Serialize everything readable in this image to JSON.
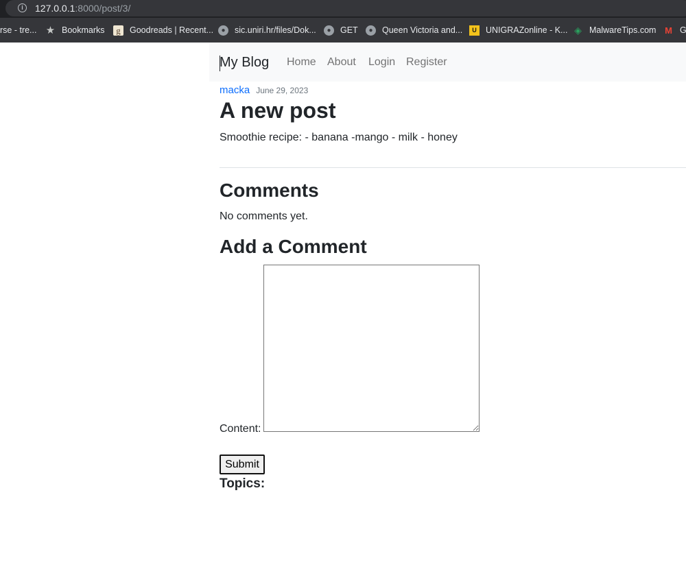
{
  "browser": {
    "url_host": "127.0.0.1",
    "url_path": ":8000/post/3/",
    "bookmarks": [
      {
        "label": "rse - tre...",
        "icon": "none"
      },
      {
        "label": "Bookmarks",
        "icon": "star-icon"
      },
      {
        "label": "Goodreads | Recent...",
        "icon": "goodreads-icon"
      },
      {
        "label": "sic.uniri.hr/files/Dok...",
        "icon": "globe-icon"
      },
      {
        "label": "GET",
        "icon": "globe-icon"
      },
      {
        "label": "Queen Victoria and...",
        "icon": "globe-icon"
      },
      {
        "label": "UNIGRAZonline - K...",
        "icon": "unigraz-icon"
      },
      {
        "label": "MalwareTips.com",
        "icon": "malwaretips-icon"
      },
      {
        "label": "G",
        "icon": "gmail-icon"
      }
    ]
  },
  "navbar": {
    "brand": "My Blog",
    "links": [
      "Home",
      "About",
      "Login",
      "Register"
    ]
  },
  "post": {
    "author": "macka",
    "date": "June 29, 2023",
    "title": "A new post",
    "body": "Smoothie recipe: - banana -mango - milk - honey"
  },
  "comments": {
    "heading": "Comments",
    "empty_text": "No comments yet."
  },
  "comment_form": {
    "heading": "Add a Comment",
    "content_label": "Content:",
    "content_value": "",
    "submit_label": "Submit"
  },
  "topics": {
    "heading": "Topics:"
  }
}
